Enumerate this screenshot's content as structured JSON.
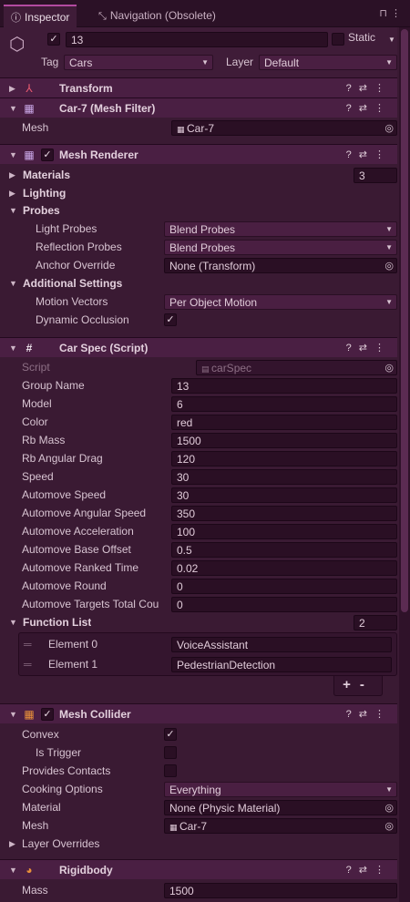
{
  "tabs": {
    "inspector": "Inspector",
    "navigation": "Navigation (Obsolete)"
  },
  "object": {
    "name": "13",
    "static_label": "Static",
    "tag_label": "Tag",
    "tag_value": "Cars",
    "layer_label": "Layer",
    "layer_value": "Default"
  },
  "transform": {
    "title": "Transform"
  },
  "mesh_filter": {
    "title": "Car-7 (Mesh Filter)",
    "mesh_label": "Mesh",
    "mesh_value": "Car-7"
  },
  "mesh_renderer": {
    "title": "Mesh Renderer",
    "materials_label": "Materials",
    "materials_count": "3",
    "lighting_label": "Lighting",
    "probes_label": "Probes",
    "light_probes_label": "Light Probes",
    "light_probes_value": "Blend Probes",
    "reflection_probes_label": "Reflection Probes",
    "reflection_probes_value": "Blend Probes",
    "anchor_override_label": "Anchor Override",
    "anchor_override_value": "None (Transform)",
    "additional_label": "Additional Settings",
    "motion_vectors_label": "Motion Vectors",
    "motion_vectors_value": "Per Object Motion",
    "dynamic_occlusion_label": "Dynamic Occlusion"
  },
  "car_spec": {
    "title": "Car Spec (Script)",
    "script_label": "Script",
    "script_value": "carSpec",
    "fields": [
      {
        "label": "Group Name",
        "value": "13"
      },
      {
        "label": "Model",
        "value": "6"
      },
      {
        "label": "Color",
        "value": "red"
      },
      {
        "label": "Rb Mass",
        "value": "1500"
      },
      {
        "label": "Rb Angular Drag",
        "value": "120"
      },
      {
        "label": "Speed",
        "value": "30"
      },
      {
        "label": "Automove Speed",
        "value": "30"
      },
      {
        "label": "Automove Angular Speed",
        "value": "350"
      },
      {
        "label": "Automove Acceleration",
        "value": "100"
      },
      {
        "label": "Automove Base Offset",
        "value": "0.5"
      },
      {
        "label": "Automove Ranked Time",
        "value": "0.02"
      },
      {
        "label": "Automove Round",
        "value": "0"
      },
      {
        "label": "Automove Targets Total Cou",
        "value": "0"
      }
    ],
    "function_list_label": "Function List",
    "function_list_count": "2",
    "elements": [
      {
        "label": "Element 0",
        "value": "VoiceAssistant"
      },
      {
        "label": "Element 1",
        "value": "PedestrianDetection"
      }
    ],
    "add_label": "+",
    "remove_label": "-"
  },
  "mesh_collider": {
    "title": "Mesh Collider",
    "convex_label": "Convex",
    "is_trigger_label": "Is Trigger",
    "provides_contacts_label": "Provides Contacts",
    "cooking_options_label": "Cooking Options",
    "cooking_options_value": "Everything",
    "material_label": "Material",
    "material_value": "None (Physic Material)",
    "mesh_label": "Mesh",
    "mesh_value": "Car-7",
    "layer_overrides_label": "Layer Overrides"
  },
  "rigidbody": {
    "title": "Rigidbody",
    "mass_label": "Mass",
    "mass_value": "1500"
  },
  "icons": {
    "check": "✓",
    "help": "?",
    "settings": "⇄",
    "more": "⋮",
    "lock": "🔒"
  }
}
